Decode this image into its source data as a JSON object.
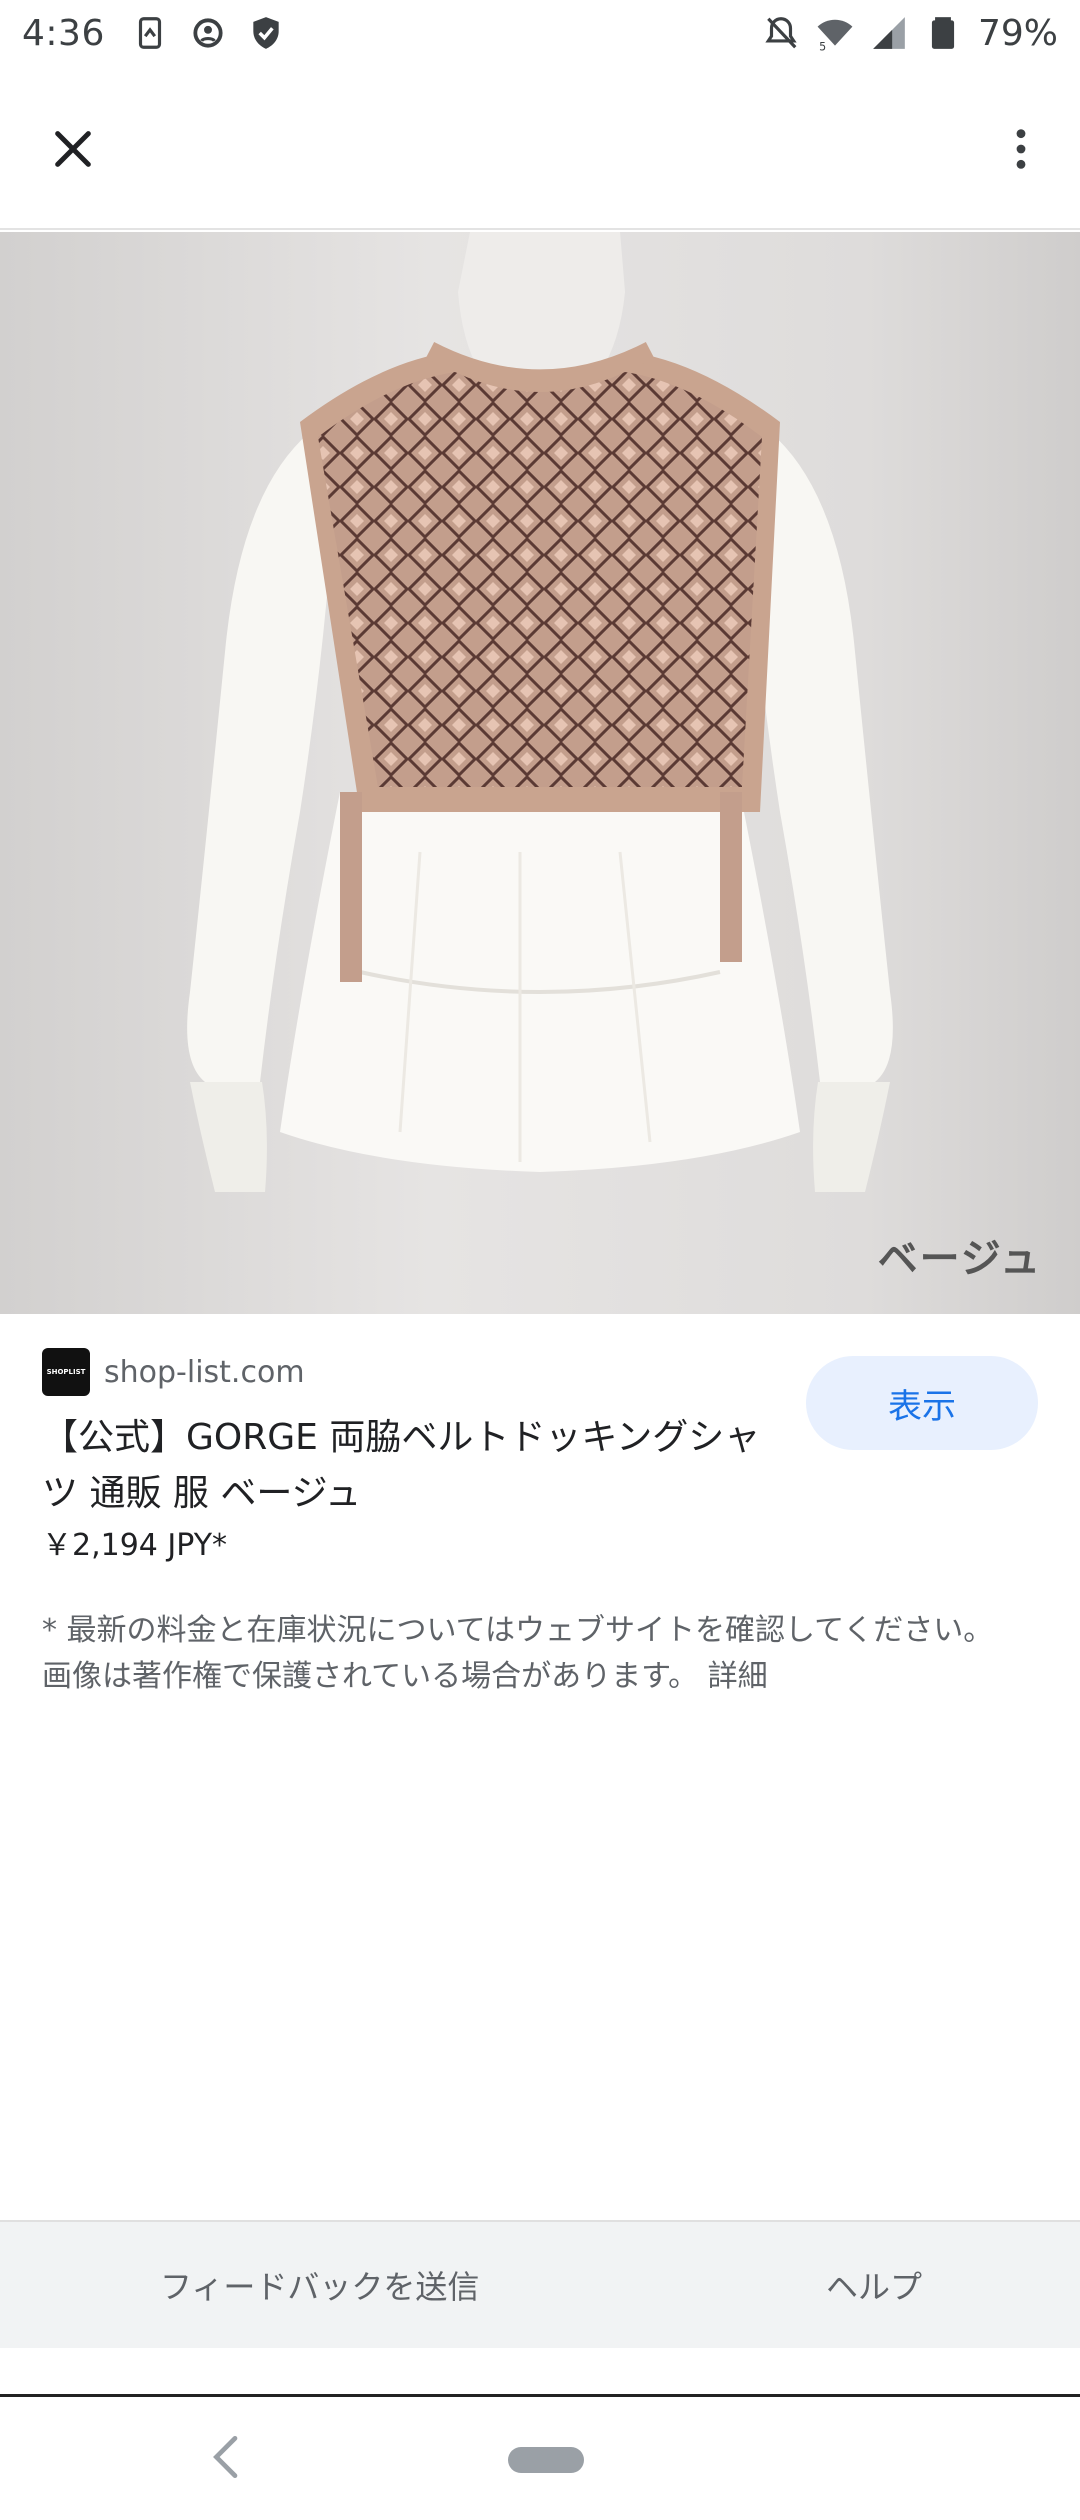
{
  "status_bar": {
    "time": "4:36",
    "battery_percent": "79%",
    "icons": [
      "data-saver-icon",
      "vpn-key-icon",
      "shield-check-icon",
      "do-not-disturb-icon",
      "wifi-icon",
      "signal-icon",
      "battery-icon"
    ]
  },
  "app_bar": {
    "close_icon": "close-icon",
    "more_icon": "more-vert-icon"
  },
  "image": {
    "caption": "ベージュ"
  },
  "result": {
    "source_logo_text": "SHOPLIST",
    "source_domain": "shop-list.com",
    "visit_label": "表示",
    "title": "【公式】GORGE 両脇ベルトドッキングシャツ 通販 服 ベージュ",
    "price": "￥2,194 JPY*",
    "disclaimer": "* 最新の料金と在庫状況についてはウェブサイトを確認してください。 画像は著作権で保護されている場合があります。",
    "details_link": "詳細"
  },
  "footer": {
    "feedback_label": "フィードバックを送信",
    "help_label": "ヘルプ"
  },
  "colors": {
    "accent": "#1a73e8",
    "visit_button_bg": "#e8f0fe",
    "footer_bg": "#f1f3f4"
  }
}
